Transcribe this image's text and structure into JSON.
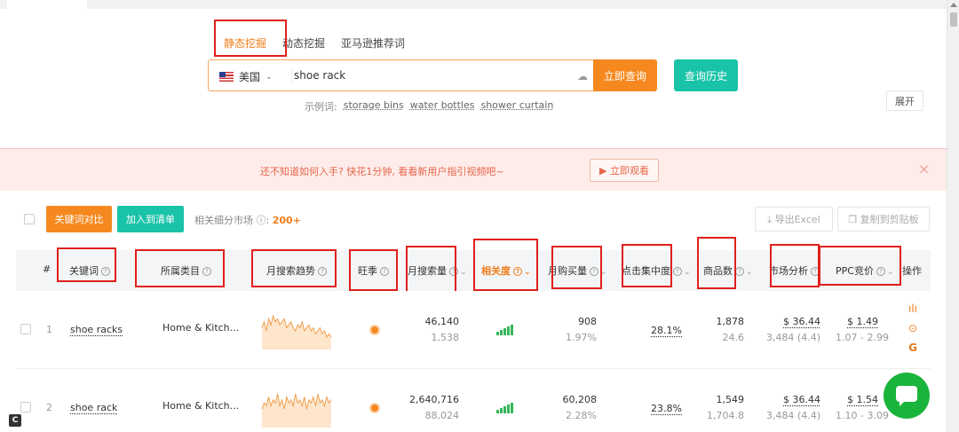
{
  "tabs": [
    {
      "label": "静态挖掘",
      "active": true
    },
    {
      "label": "动态挖掘",
      "active": false
    },
    {
      "label": "亚马逊推荐词",
      "active": false
    }
  ],
  "search": {
    "country": "美国",
    "query": "shoe rack",
    "submit_label": "立即查询",
    "history_label": "查询历史"
  },
  "examples": {
    "label": "示例词:",
    "items": [
      "storage bins",
      "water bottles",
      "shower curtain"
    ]
  },
  "expand_label": "展开",
  "banner": {
    "message": "还不知道如何入手? 快花1分钟, 看看新用户指引视频吧~",
    "watch_label": "立即观看",
    "close": "×"
  },
  "toolbar": {
    "compare_label": "关键词对比",
    "add_label": "加入到清单",
    "related_label": "相关细分市场",
    "related_count": "200+",
    "excel_label": "导出Excel",
    "copy_label": "复制到剪贴板"
  },
  "columns": [
    "#",
    "关键词",
    "所属类目",
    "月搜索趋势",
    "旺季",
    "月搜索量",
    "相关度",
    "月购买量",
    "点击集中度",
    "商品数",
    "市场分析",
    "PPC竞价",
    "操作"
  ],
  "rows": [
    {
      "index": "1",
      "keyword": "shoe racks",
      "category": "Home & Kitch...",
      "search_volume": "46,140",
      "search_rank": "1,538",
      "purchases": "908",
      "purchase_rate": "1.97%",
      "click_share": "28.1%",
      "products": "1,878",
      "products_ratio": "24.6",
      "market_price": "$ 36.44",
      "market_sub": "3,484 (4.4)",
      "ppc": "$ 1.49",
      "ppc_range": "1.07 - 2.99",
      "trend": [
        6,
        8,
        5,
        9,
        7,
        10,
        8,
        9,
        7,
        8,
        9,
        6,
        7,
        8,
        6,
        5,
        7,
        6,
        8,
        5,
        6,
        7,
        5,
        6,
        4,
        5,
        6,
        4,
        5,
        3,
        4,
        3
      ]
    },
    {
      "index": "2",
      "keyword": "shoe rack",
      "category": "Home & Kitch...",
      "search_volume": "2,640,716",
      "search_rank": "88,024",
      "purchases": "60,208",
      "purchase_rate": "2.28%",
      "click_share": "23.8%",
      "products": "1,549",
      "products_ratio": "1,704.8",
      "market_price": "$ 36.44",
      "market_sub": "3,484 (4.4)",
      "ppc": "$ 1.54",
      "ppc_range": "1.10 - 3.09",
      "trend": [
        5,
        7,
        6,
        9,
        6,
        8,
        7,
        10,
        6,
        8,
        5,
        9,
        7,
        8,
        6,
        10,
        7,
        8,
        6,
        9,
        5,
        8,
        7,
        9,
        6,
        10,
        7,
        8,
        6,
        9,
        7,
        8
      ]
    }
  ]
}
